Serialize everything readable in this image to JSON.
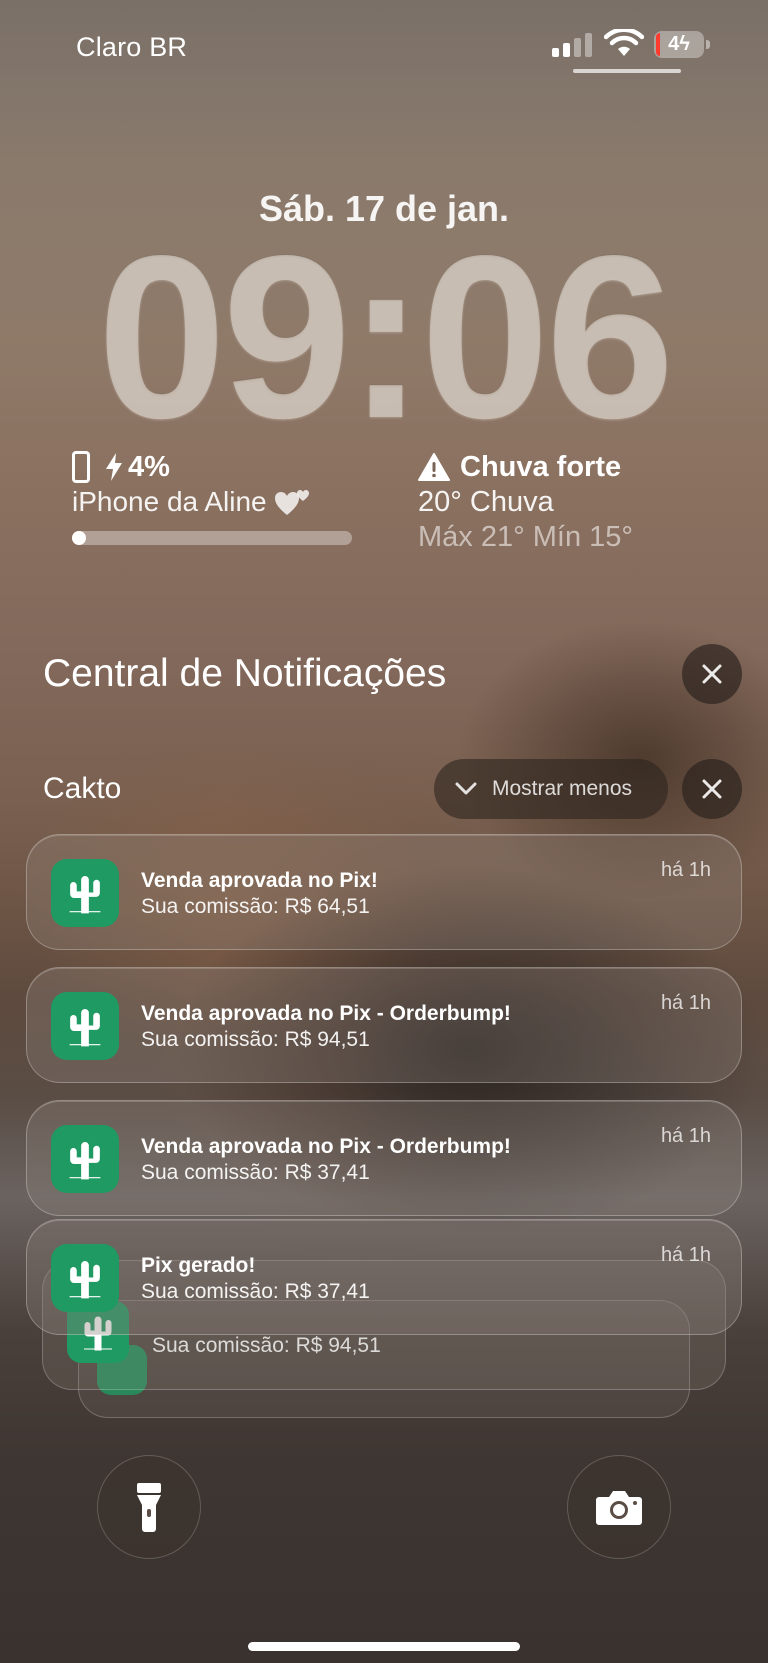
{
  "status_bar": {
    "carrier": "Claro BR",
    "battery_text": "4",
    "battery_level": 0.04,
    "icons": [
      "cellular-signal-icon",
      "wifi-icon",
      "battery-charging-icon"
    ]
  },
  "lock_screen": {
    "date": "Sáb. 17 de jan.",
    "time": "09:06"
  },
  "widgets": {
    "battery": {
      "percent": "4%",
      "device_name": "iPhone da Aline",
      "level": 0.04
    },
    "weather": {
      "alert": "Chuva forte",
      "condition": "20° Chuva",
      "range": "Máx 21° Mín 15°"
    }
  },
  "notification_center": {
    "title": "Central de Notificações",
    "group": {
      "app_name": "Cakto",
      "show_less_label": "Mostrar menos"
    },
    "notifications": [
      {
        "title": "Venda aprovada no Pix!",
        "body": "Sua comissão: R$ 64,51",
        "time": "há 1h"
      },
      {
        "title": "Venda aprovada no Pix - Orderbump!",
        "body": "Sua comissão: R$ 94,51",
        "time": "há 1h"
      },
      {
        "title": "Venda aprovada no Pix - Orderbump!",
        "body": "Sua comissão: R$ 37,41",
        "time": "há 1h"
      },
      {
        "title": "Pix gerado!",
        "body": "Sua comissão: R$ 37,41",
        "time": "há 1h"
      }
    ],
    "stacked_preview_body": "Sua comissão: R$ 94,51"
  },
  "colors": {
    "app_icon_green": "#1f9a62",
    "battery_low_red": "#ff3b30"
  }
}
